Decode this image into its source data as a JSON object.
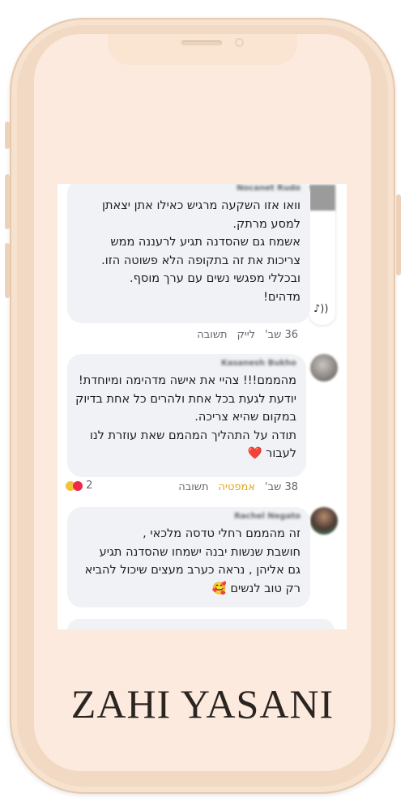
{
  "comments": [
    {
      "author": "Nocanet Rudo",
      "lines": [
        "וואו אזו השקעה מרגיש כאילו אתן יצאתן",
        "למסע מרתק.",
        "אשמח גם שהסדנה תגיע לרעננה ממש",
        "צריכות את זה בתקופה הלא פשוטה הזו.",
        "ובכללי מפגשי נשים עם ערך מוסף.",
        "מדהים!"
      ],
      "time": "36 שב'",
      "like": "לייק",
      "reply": "תשובה"
    },
    {
      "author": "Kasanesh Bukho",
      "lines": [
        "מהממם!!! צהיי את אישה מדהימה ומיוחדת!",
        "יודעת לגעת בכל אחת ולהרים כל אחת בדיוק",
        "במקום שהיא צריכה.",
        "תודה על התהליך המהמם שאת עוזרת לנו",
        "לעבור ❤️"
      ],
      "time": "38 שב'",
      "like": "אמפטיה",
      "reply": "תשובה",
      "reaction_count": "2"
    },
    {
      "author": "Rachel Negato",
      "lines": [
        "זה מהממם רחלי טדסה מלכאי ,",
        "חושבת שנשות יבנה ישמחו שהסדנה תגיע",
        "גם אליהן , נראה כערב מעצים שיכול להביא",
        "רק טוב לנשים 🥰"
      ]
    }
  ],
  "brand": "ZAHI YASANI",
  "colors": {
    "frame": "#f1d9c3",
    "screen": "#fbeadd",
    "bubble": "#f0f2f5",
    "accent": "#e4a51c"
  },
  "icons": [
    "sound-wave-icon",
    "heart-icon",
    "reaction-icons"
  ]
}
